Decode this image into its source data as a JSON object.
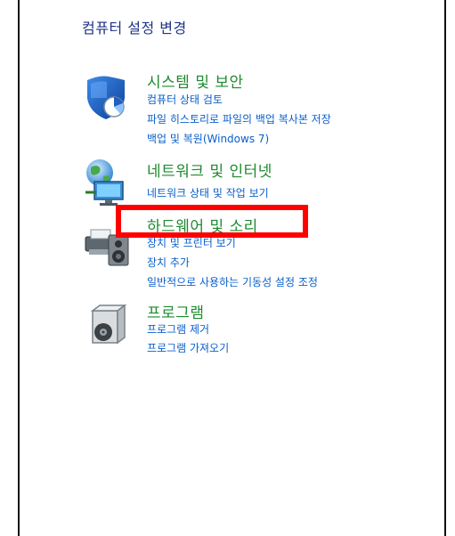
{
  "window": {
    "title": "컴퓨터 설정 변경"
  },
  "categories": [
    {
      "title": "시스템 및 보안",
      "icon": "shield-icon",
      "links": [
        "컴퓨터 상태 검토",
        "파일 히스토리로 파일의 백업 복사본 저장",
        "백업 및 복원(Windows 7)"
      ]
    },
    {
      "title": "네트워크 및 인터넷",
      "icon": "network-globe-icon",
      "links": [
        "네트워크 상태 및 작업 보기"
      ]
    },
    {
      "title": "하드웨어 및 소리",
      "icon": "printer-speaker-icon",
      "links": [
        "장치 및 프린터 보기",
        "장치 추가",
        "일반적으로 사용하는 기동성 설정 조정"
      ]
    },
    {
      "title": "프로그램",
      "icon": "program-box-icon",
      "links": [
        "프로그램 제거",
        "프로그램 가져오기"
      ]
    }
  ],
  "colors": {
    "title": "#1e3287",
    "category": "#1e8a2f",
    "link": "#0a5fcc",
    "highlight": "#ff0000"
  }
}
